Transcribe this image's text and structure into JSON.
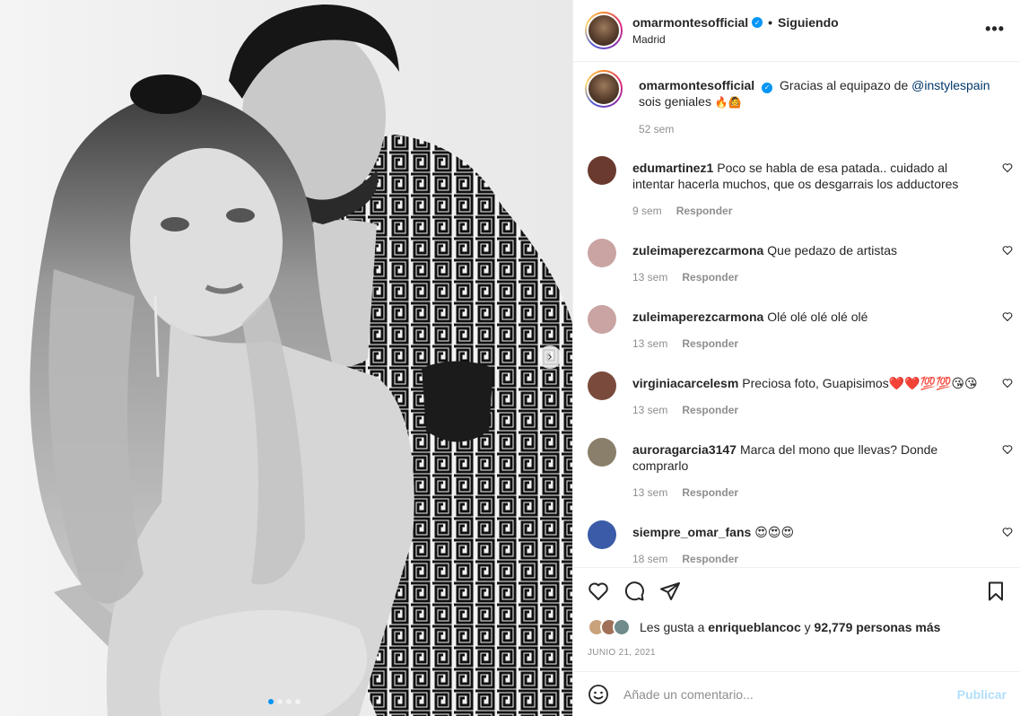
{
  "header": {
    "username": "omarmontesofficial",
    "separator": "•",
    "follow_status": "Siguiendo",
    "location": "Madrid",
    "more_label": "•••"
  },
  "caption": {
    "username": "omarmontesofficial",
    "text_before": "Gracias al equipazo de ",
    "mention": "@instylespain",
    "text_after": " sois geniales ",
    "emojis": "🔥🙆",
    "time": "52 sem"
  },
  "comments": [
    {
      "username": "edumartinez1",
      "text": "Poco se habla de esa patada.. cuidado al intentar hacerla muchos, que os desgarrais los adductores",
      "time": "9 sem",
      "reply": "Responder",
      "avatar_color": "#6b3a2e"
    },
    {
      "username": "zuleimaperezcarmona",
      "text": "Que pedazo de artistas",
      "time": "13 sem",
      "reply": "Responder",
      "avatar_color": "#c9a4a2"
    },
    {
      "username": "zuleimaperezcarmona",
      "text": "Olé olé olé olé olé",
      "time": "13 sem",
      "reply": "Responder",
      "avatar_color": "#c9a4a2"
    },
    {
      "username": "virginiacarcelesm",
      "text": "Preciosa foto, Guapisimos❤️❤️💯💯😘😘",
      "time": "13 sem",
      "reply": "Responder",
      "avatar_color": "#7a4a3c"
    },
    {
      "username": "auroragarcia3147",
      "text": "Marca del mono que llevas? Donde comprarlo",
      "time": "13 sem",
      "reply": "Responder",
      "avatar_color": "#8a7f6a"
    },
    {
      "username": "siempre_omar_fans",
      "text": "😍😍😍",
      "time": "18 sem",
      "reply": "Responder",
      "avatar_color": "#3b5ba8"
    }
  ],
  "likes": {
    "prefix": "Les gusta a ",
    "user": "enriqueblancoc",
    "middle": " y ",
    "count": "92,779 personas más",
    "avatar_colors": [
      "#c8a27a",
      "#a07058",
      "#6f8b8a"
    ]
  },
  "date": "JUNIO 21, 2021",
  "add_comment": {
    "placeholder": "Añade un comentario...",
    "publish_label": "Publicar"
  },
  "colors": {
    "accent": "#0095f6",
    "publish_disabled": "#b2dffc",
    "muted": "#8e8e8e",
    "text": "#262626"
  },
  "icons": [
    "more-options-icon",
    "verified-icon",
    "heart-icon",
    "comment-icon",
    "share-icon",
    "bookmark-icon",
    "emoji-icon",
    "next-arrow-icon"
  ]
}
